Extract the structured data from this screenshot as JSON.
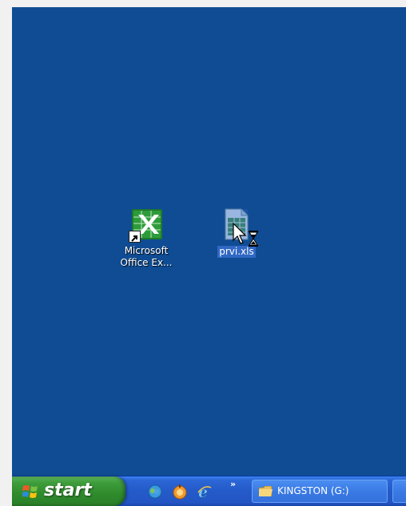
{
  "desktop": {
    "background_color": "#0f4c93",
    "icons": [
      {
        "label": "Microsoft\nOffice Ex...",
        "icon": "excel-app-icon",
        "shortcut": true,
        "selected": false
      },
      {
        "label": "prvi.xls",
        "icon": "excel-file-icon",
        "shortcut": false,
        "selected": true
      }
    ]
  },
  "cursor": {
    "type": "busy-arrow-icon"
  },
  "taskbar": {
    "start_label": "start",
    "quick_launch": [
      {
        "name": "messenger-icon"
      },
      {
        "name": "media-player-icon"
      },
      {
        "name": "internet-explorer-icon"
      }
    ],
    "overflow_label": "»",
    "tasks": [
      {
        "label": "KINGSTON (G:)",
        "icon": "folder-icon"
      }
    ],
    "colors": {
      "taskbar": "#245ac9",
      "start_button": "#3f9d3c"
    }
  }
}
